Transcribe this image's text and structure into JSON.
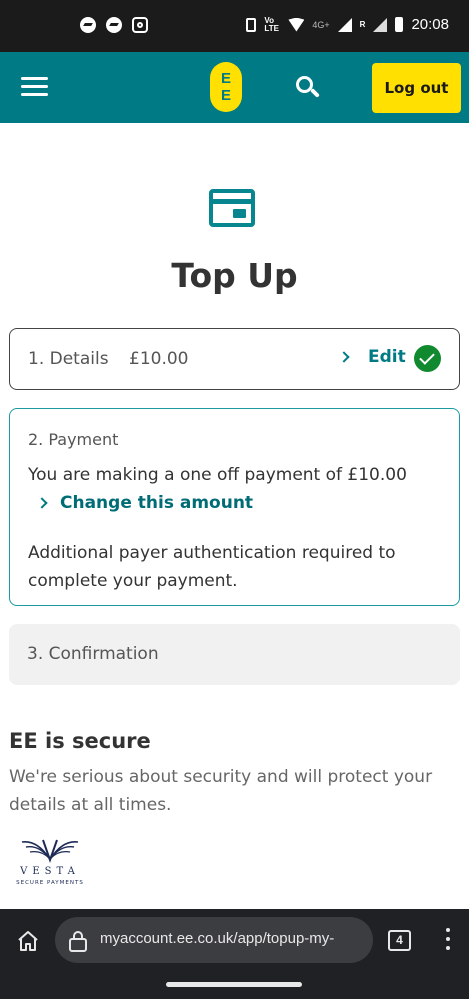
{
  "status_bar": {
    "time": "20:08",
    "volte_label": "Vo LTE",
    "network_label": "4G+",
    "roaming_label": "R"
  },
  "header": {
    "logo_text": [
      "E",
      "E"
    ],
    "logout_label": "Log out",
    "brand_color": "#007b85",
    "accent_color": "#ffe000"
  },
  "page": {
    "title": "Top Up"
  },
  "steps": {
    "details": {
      "label": "1. Details",
      "amount": "£10.00",
      "edit_label": "Edit",
      "status": "complete"
    },
    "payment": {
      "label": "2. Payment",
      "message": "You are making a one off payment of £10.00",
      "change_label": "Change this amount",
      "auth_message": "Additional payer authentication required to complete your payment."
    },
    "confirmation": {
      "label": "3. Confirmation"
    }
  },
  "security": {
    "title": "EE is secure",
    "text": "We're serious about security and will protect your details at all times.",
    "logo_name": "VESTA",
    "logo_sub": "SECURE PAYMENTS"
  },
  "browser": {
    "url": "myaccount.ee.co.uk/app/topup-my-",
    "tab_count": "4"
  }
}
